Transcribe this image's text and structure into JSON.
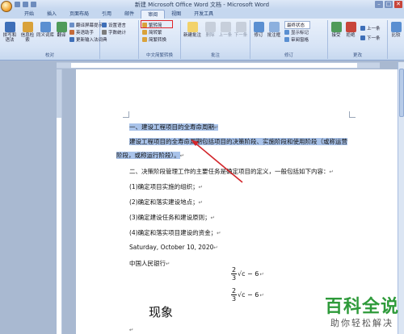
{
  "window": {
    "title": "新建 Microsoft Office Word 文档 - Microsoft Word",
    "controls": [
      "–",
      "□",
      "✕"
    ]
  },
  "tabs": [
    "开始",
    "插入",
    "页面布局",
    "引用",
    "邮件",
    "审阅",
    "视图",
    "开发工具"
  ],
  "active_tab": "审阅",
  "ribbon": {
    "proofing": {
      "label": "校对",
      "spell": "拼写和语法",
      "info": "信息检索",
      "thesaurus": "同义词库",
      "translate": "翻译",
      "translate_tip": "翻译屏幕提示",
      "language": "设置语言",
      "wordcount": "字数统计",
      "english_assist": "英语助手",
      "update_ime": "更新输入法词典"
    },
    "chinese": {
      "label": "中文简繁转换",
      "to_simplified": "繁转简",
      "to_traditional": "简转繁",
      "convert": "简繁转换"
    },
    "comments": {
      "label": "批注",
      "new": "新建批注",
      "delete": "删除",
      "prev": "上一条",
      "next": "下一条"
    },
    "tracking": {
      "label": "修订",
      "track": "修订",
      "balloons": "批注框",
      "markup": "最终状态",
      "show_markup": "显示标记",
      "reviewing_pane": "审阅窗格"
    },
    "changes": {
      "label": "更改",
      "accept": "接受",
      "reject": "拒绝",
      "prev": "上一条",
      "next": "下一条"
    },
    "compare": {
      "label": "比较",
      "compare": "比较"
    }
  },
  "document": {
    "lines": [
      "一、建设工程项目的全寿命周期",
      "建设工程项目的全寿命周期包括项目的决策阶段、实施阶段和使用阶段（或称运营",
      "阶段，或称运行阶段）。",
      "二、决策阶段管理工作的主要任务是确定项目的定义，一般包括如下内容：",
      "(1)确定项目实施的组织；",
      "(2)确定和落实建设地点；",
      "(3)确定建设任务和建设原则；",
      "(4)确定和落实项目建设的资金；",
      "Saturday, October 10, 2020",
      "中国人民银行",
      "现象"
    ],
    "formula_num": "2",
    "formula_den": "3",
    "formula_rest": "√c − 6",
    "para_mark": "↵"
  },
  "watermark": {
    "line1": "百科全说",
    "line2": "助你轻松解决"
  },
  "colors": {
    "selection": "#a9c3ea",
    "highlight_box": "#e0262b",
    "arrow": "#d2262b"
  }
}
